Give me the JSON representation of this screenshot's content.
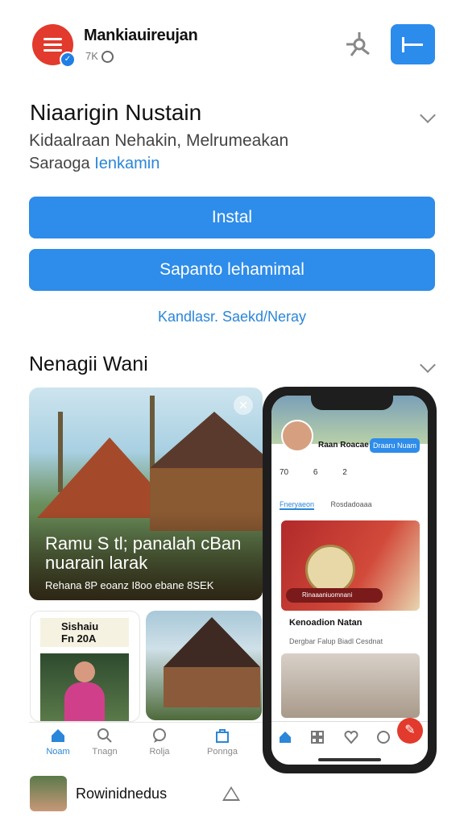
{
  "header": {
    "app_name": "Mankiauireujan",
    "meta": "7K",
    "share_icon": "share-icon",
    "action_icon": "collapse-icon"
  },
  "info": {
    "title": "Niaarigin Nustain",
    "subtitle": "Kidaalraan Nehakin, Melrumeakan",
    "developer_prefix": "Saraoga",
    "developer_link": "Ienkamin"
  },
  "buttons": {
    "primary": "Instal",
    "secondary": "Sapanto lehamimal"
  },
  "link_text": "Kandlasr. Saekd/Neray",
  "gallery": {
    "section_title": "Nenagii Wani",
    "big_caption": "Ramu S tl; panalah cBan nuarain larak",
    "big_subcaption": "Rehana 8P eoanz I8oo ebane 8SEK",
    "card2_tag_line1": "Sishaiu",
    "card2_tag_line2": "Fn 20A",
    "nav": [
      {
        "label": "Noam",
        "icon": "home-icon"
      },
      {
        "label": "Tnagn",
        "icon": "search-icon"
      },
      {
        "label": "Rolja",
        "icon": "chat-icon"
      },
      {
        "label": "Ponnga",
        "icon": "bag-icon"
      }
    ]
  },
  "phone": {
    "profile_name": "Raan Roacae",
    "follow_label": "Draaru Nuam",
    "stats": [
      "70",
      "6",
      "2"
    ],
    "tab_active": "Fneryaeon",
    "tab_other": "Rosdadoaaa",
    "post_badge": "Rinaaaniuomnani",
    "post_title": "Kenoadion Natan",
    "post_desc": "Dergbar Falup Biadl Cesdnat"
  },
  "bottom_row": {
    "name": "Rowinidnedus"
  },
  "colors": {
    "accent": "#2e8cea",
    "brand_red": "#e23a2c"
  }
}
